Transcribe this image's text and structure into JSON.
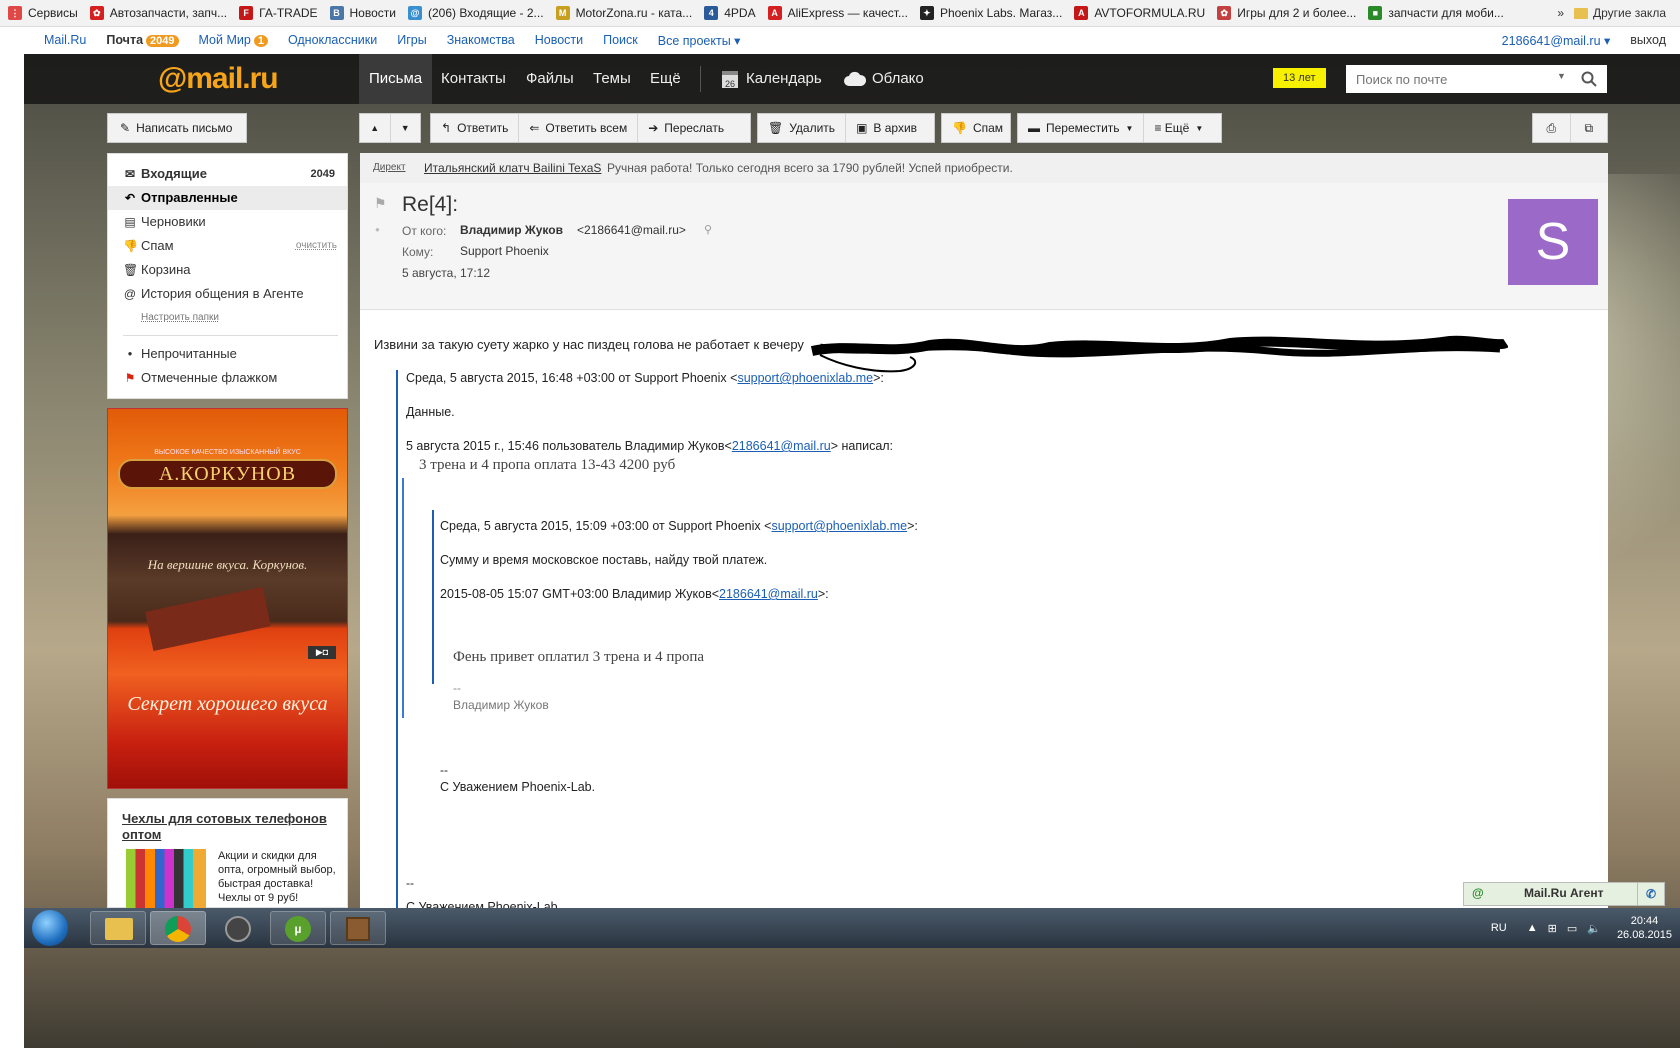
{
  "bookmarks": [
    {
      "label": "Сервисы",
      "color": "#e04848",
      "glyph": "⋮"
    },
    {
      "label": "Автозапчасти, запч...",
      "color": "#d42020",
      "glyph": "✿"
    },
    {
      "label": "ГА-TRADE",
      "color": "#c41818",
      "glyph": "F"
    },
    {
      "label": "Новости",
      "color": "#4a76a8",
      "glyph": "B"
    },
    {
      "label": "(206) Входящие - 2...",
      "color": "#3a8fd0",
      "glyph": "@"
    },
    {
      "label": "MotorZona.ru - ката...",
      "color": "#c8a020",
      "glyph": "M"
    },
    {
      "label": "4PDA",
      "color": "#2a5a9a",
      "glyph": "4"
    },
    {
      "label": "AliExpress — качест...",
      "color": "#d42020",
      "glyph": "A"
    },
    {
      "label": "Phoenix Labs. Магаз...",
      "color": "#222222",
      "glyph": "✦"
    },
    {
      "label": "AVTOFORMULA.RU",
      "color": "#c41818",
      "glyph": "A"
    },
    {
      "label": "Игры для 2 и более...",
      "color": "#c44040",
      "glyph": "✿"
    },
    {
      "label": "запчасти для моби...",
      "color": "#2a8a2a",
      "glyph": "■"
    }
  ],
  "bookmarks_more": "»",
  "bookmarks_other": "Другие закла",
  "portal": {
    "links": [
      "Mail.Ru",
      "Почта",
      "Мой Мир",
      "Одноклассники",
      "Игры",
      "Знакомства",
      "Новости",
      "Поиск",
      "Все проекты ▾"
    ],
    "pochta_count": "2049",
    "mymir_count": "1",
    "user": "2186641@mail.ru ▾",
    "logout": "выход"
  },
  "header": {
    "logo": "@mail.ru",
    "tabs": [
      "Письма",
      "Контакты",
      "Файлы",
      "Темы",
      "Ещё"
    ],
    "calendar": "Календарь",
    "calendar_day": "26",
    "cloud": "Облако",
    "age_badge": "13 лет",
    "search_placeholder": "Поиск по почте"
  },
  "toolbar": {
    "compose": "Написать письмо",
    "reply": "Ответить",
    "reply_all": "Ответить всем",
    "forward": "Переслать",
    "delete": "Удалить",
    "archive": "В архив",
    "spam": "Спам",
    "move": "Переместить",
    "more": "≡ Ещё"
  },
  "folders": {
    "inbox": "Входящие",
    "inbox_count": "2049",
    "sent": "Отправленные",
    "drafts": "Черновики",
    "spam": "Спам",
    "spam_clear": "очистить",
    "trash": "Корзина",
    "agent_history": "История общения в Агенте",
    "setup": "Настроить папки",
    "unread": "Непрочитанные",
    "flagged": "Отмеченные флажком"
  },
  "ad_banner": {
    "brand": "А.КОРКУНОВ",
    "tagline_top": "ВЫСОКОЕ КАЧЕСТВО     ИЗЫСКАННЫЙ ВКУС",
    "script1": "На вершине вкуса. Коркунов.",
    "script2": "Секрет хорошего вкуса"
  },
  "ad_small": {
    "title": "Чехлы для сотовых телефонов оптом",
    "text": "Акции и скидки для опта, огромный выбор, быстрая доставка! Чехлы от 9 руб!"
  },
  "direct_ad": {
    "label": "Директ",
    "link": "Итальянский клатч Bailini TexaS",
    "text": "Ручная работа! Только сегодня всего за 1790 рублей! Успей приобрести."
  },
  "message": {
    "subject": "Re[4]:",
    "from_label": "От кого:",
    "from_name": "Владимир Жуков",
    "from_email": "<2186641@mail.ru>",
    "to_label": "Кому:",
    "to": "Support Phoenix",
    "date": "5 августа, 17:12",
    "avatar_letter": "S",
    "body_line": "Извини за такую суету жарко у нас пиздец голова не работает к вечеру",
    "q1_header_pre": "Среда, 5 августа 2015, 16:48 +03:00 от Support Phoenix <",
    "q1_header_link": "support@phoenixlab.me",
    "q1_header_post": ">:",
    "q1_text": "Данные.",
    "q1_attr_pre": "5 августа 2015 г., 15:46 пользователь Владимир Жуков<",
    "q1_attr_link": "2186641@mail.ru",
    "q1_attr_post": "> написал:",
    "q1_serif": "3 трена и 4 пропа оплата 13-43 4200 руб",
    "q2_header_pre": "Среда, 5 августа 2015, 15:09 +03:00 от Support Phoenix <",
    "q2_header_link": "support@phoenixlab.me",
    "q2_header_post": ">:",
    "q2_text": "Сумму и время московское поставь, найду твой платеж.",
    "q2_attr_pre": "2015-08-05 15:07 GMT+03:00 Владимир Жуков<",
    "q2_attr_link": "2186641@mail.ru",
    "q2_attr_post": ">:",
    "q3_serif": "Фень привет оплатил 3 трена и 4 пропа",
    "q3_dashes": "--",
    "q3_sig": "Владимир Жуков",
    "q2_dashes": "--",
    "q2_sig": "С Уважением Phoenix-Lab.",
    "q1_dashes": "--",
    "q1_sig": "С Уважением Phoenix-Lab."
  },
  "agent": {
    "label": "Mail.Ru Агент"
  },
  "taskbar": {
    "lang": "RU",
    "time": "20:44",
    "date": "26.08.2015"
  }
}
